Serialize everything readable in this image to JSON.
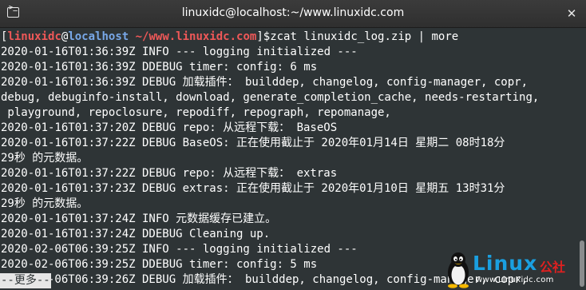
{
  "window": {
    "title": "linuxidc@localhost:~/www.linuxidc.com",
    "close_glyph": "✕",
    "icon": "terminal-icon"
  },
  "terminal": {
    "prompt": {
      "open": "[",
      "user": "linuxidc",
      "at": "@",
      "host": "localhost",
      "path": " ~/www.linuxidc.com",
      "close": "]$",
      "command": "zcat linuxidc_log.zip | more"
    },
    "lines": [
      "2020-01-16T01:36:39Z INFO --- logging initialized ---",
      "2020-01-16T01:36:39Z DDEBUG timer: config: 6 ms",
      "2020-01-16T01:36:39Z DEBUG 加载插件： builddep, changelog, config-manager, copr,",
      "debug, debuginfo-install, download, generate_completion_cache, needs-restarting,",
      " playground, repoclosure, repodiff, repograph, repomanage,",
      "2020-01-16T01:37:20Z DEBUG repo: 从远程下载： BaseOS",
      "2020-01-16T01:37:22Z DEBUG BaseOS: 正在使用截止于 2020年01月14日 星期二 08时18分",
      "29秒 的元数据。",
      "2020-01-16T01:37:22Z DEBUG repo: 从远程下载： extras",
      "2020-01-16T01:37:23Z DEBUG extras: 正在使用截止于 2020年01月10日 星期五 13时31分",
      "29秒 的元数据。",
      "2020-01-16T01:37:24Z INFO 元数据缓存已建立。",
      "2020-01-16T01:37:24Z DDEBUG Cleaning up.",
      "2020-02-06T06:39:25Z INFO --- logging initialized ---",
      "2020-02-06T06:39:25Z DDEBUG timer: config: 5 ms",
      "2020-02-06T06:39:26Z DEBUG 加载插件： builddep, changelog, config-manager, copr,"
    ],
    "pager_status": "--更多--"
  },
  "watermark": {
    "brand": "Linux",
    "brand_cn": "公社",
    "url": "www.Linuxidc.com",
    "icon": "tux-penguin-icon"
  },
  "colors": {
    "background": "#2e3436",
    "prompt_user": "#ef5858",
    "prompt_host": "#78a8e8",
    "watermark_blue": "#1a9fe0",
    "watermark_red": "#e02020"
  }
}
